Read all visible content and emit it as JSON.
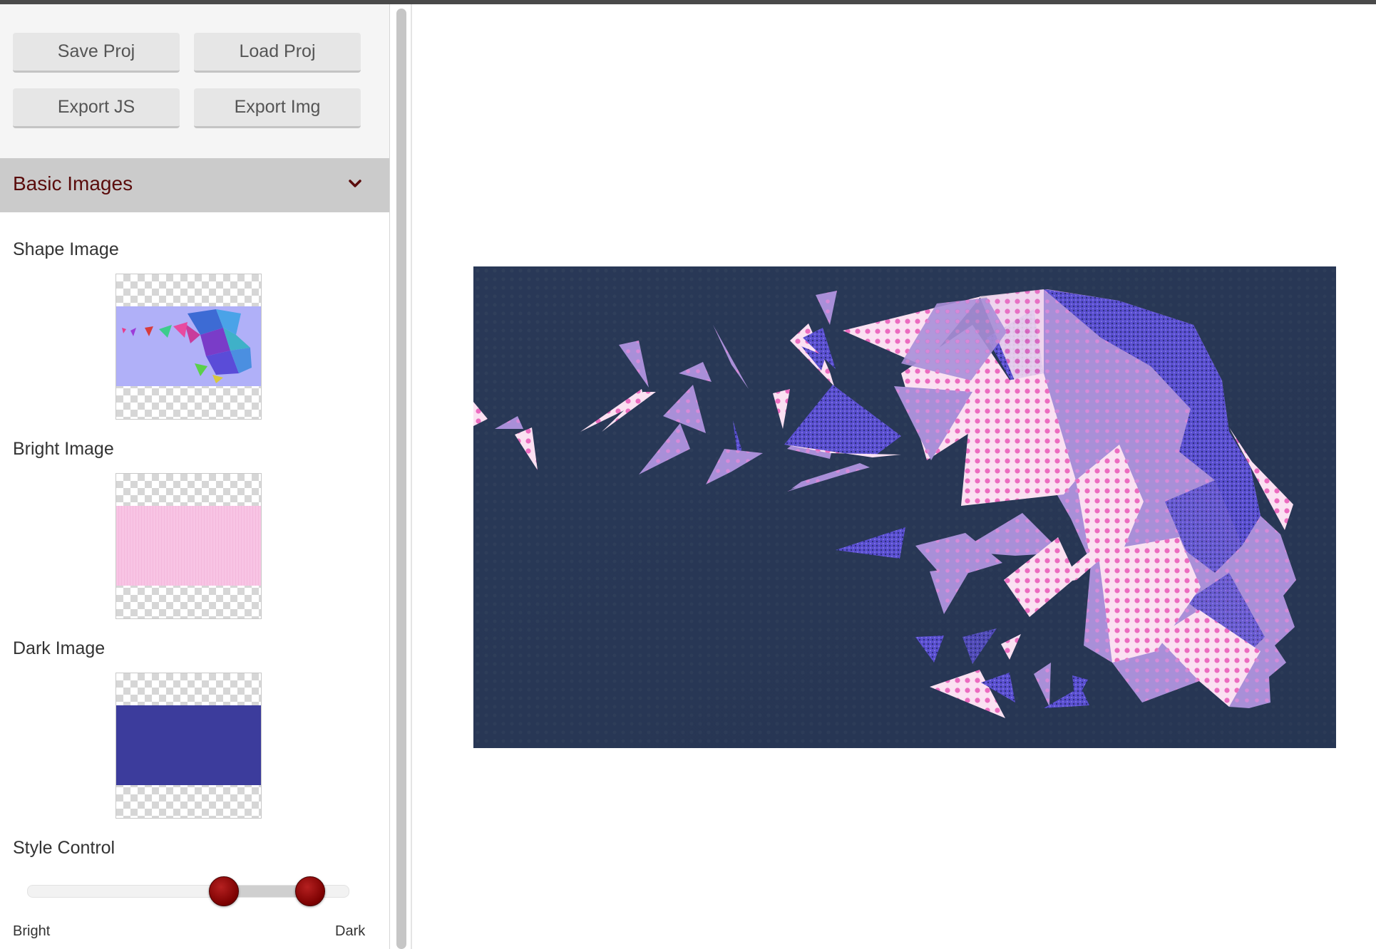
{
  "toolbar": {
    "save_label": "Save Proj",
    "load_label": "Load Proj",
    "export_js_label": "Export JS",
    "export_img_label": "Export Img"
  },
  "panel": {
    "title": "Basic Images",
    "shape_label": "Shape Image",
    "bright_label": "Bright Image",
    "dark_label": "Dark Image",
    "style_label": "Style Control"
  },
  "style_control": {
    "min_label": "Bright",
    "max_label": "Dark",
    "low_value": 0.61,
    "high_value": 0.88
  },
  "colors": {
    "header_text": "#5a0c0c",
    "shape_bg": "#b0b0f8",
    "bright_fill": "#f8c4e4",
    "dark_fill": "#3c3c9c",
    "canvas_bg": "#2a3a5a",
    "handle": "#8a0000"
  },
  "icons": {
    "collapse": "chevron-down-icon"
  }
}
